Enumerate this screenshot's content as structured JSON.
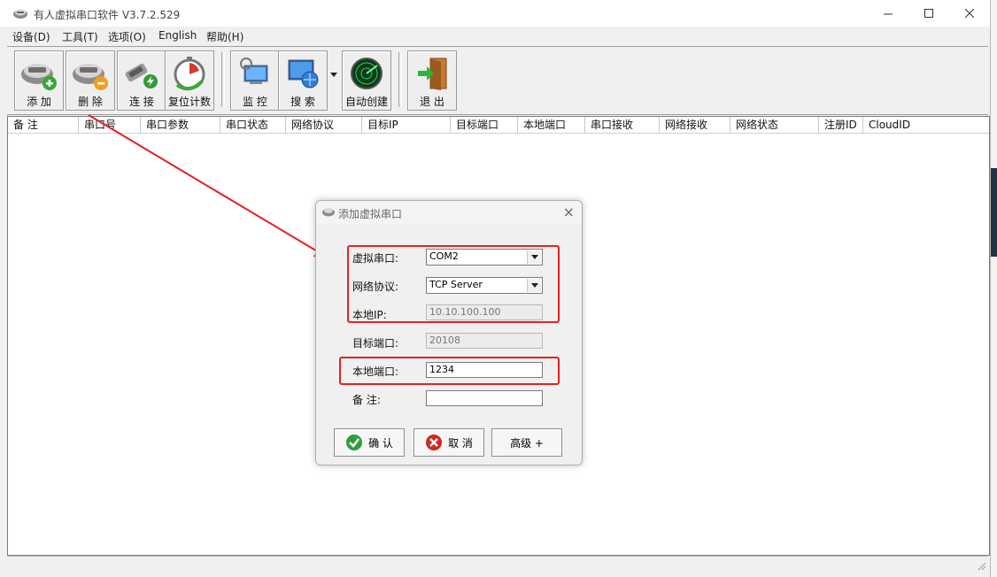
{
  "window": {
    "title": "有人虚拟串口软件 V3.7.2.529"
  },
  "menu": [
    "设备(D)",
    "工具(T)",
    "选项(O)",
    "English",
    "帮助(H)"
  ],
  "toolbar": {
    "add": "添 加",
    "delete": "删 除",
    "connect": "连 接",
    "reset": "复位计数",
    "monitor": "监 控",
    "search": "搜 索",
    "auto_create": "自动创建",
    "exit": "退 出"
  },
  "columns": [
    "备 注",
    "串口号",
    "串口参数",
    "串口状态",
    "网络协议",
    "目标IP",
    "目标端口",
    "本地端口",
    "串口接收",
    "网络接收",
    "网络状态",
    "注册ID",
    "CloudID"
  ],
  "dialog": {
    "title": "添加虚拟串口",
    "virtual_port_label": "虚拟串口:",
    "virtual_port_value": "COM2",
    "protocol_label": "网络协议:",
    "protocol_value": "TCP Server",
    "local_ip_label": "本地IP:",
    "local_ip_value": "10.10.100.100",
    "target_port_label": "目标端口:",
    "target_port_value": "20108",
    "local_port_label": "本地端口:",
    "local_port_value": "1234",
    "note_label": "备  注:",
    "note_value": "",
    "ok": "确 认",
    "cancel": "取 消",
    "advanced": "高级 +"
  },
  "colors": {
    "highlight": "#e52222",
    "ok_green": "#2e9e3a",
    "cancel_red": "#cc2b1d"
  }
}
